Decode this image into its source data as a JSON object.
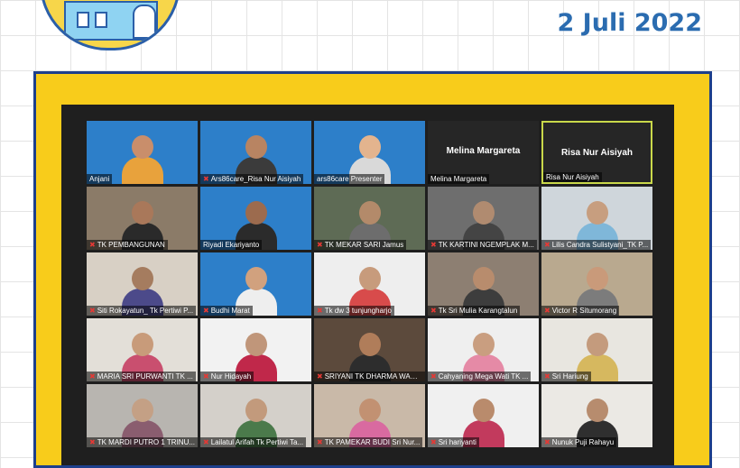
{
  "event": {
    "date": "2 Juli 2022"
  },
  "colors": {
    "frame": "#f8cc1b",
    "frame_border": "#1d3f8c",
    "date": "#2b6cb0",
    "mic_muted": "#e53935",
    "active_speaker": "#c9d84a"
  },
  "participants": [
    {
      "name": "Anjani",
      "muted": false,
      "style": "blue",
      "skin": "#c98e6b",
      "cloth": "#e8a23c"
    },
    {
      "name": "Ars86care_Risa Nur Aisiyah",
      "muted": true,
      "style": "blue",
      "skin": "#b88462",
      "cloth": "#3b3b3b"
    },
    {
      "name": "ars86care Presenter",
      "muted": false,
      "style": "blue",
      "skin": "#e3b48e",
      "cloth": "#d9d9d9"
    },
    {
      "name": "Melina Margareta",
      "muted": false,
      "style": "dark",
      "display": "Melina Margareta"
    },
    {
      "name": "Risa Nur Aisiyah",
      "muted": false,
      "style": "dark",
      "display": "Risa Nur Aisiyah",
      "active": true
    },
    {
      "name": "TK PEMBANGUNAN",
      "muted": true,
      "style": "photo",
      "bgc": "#8b7b68",
      "skin": "#a9785a",
      "cloth": "#2a2a2a"
    },
    {
      "name": "Riyadi Ekariyanto",
      "muted": false,
      "style": "blue",
      "skin": "#9c6b4e",
      "cloth": "#2b2b2b"
    },
    {
      "name": "TK MEKAR SARI Jamus",
      "muted": true,
      "style": "photo",
      "bgc": "#5e6b55",
      "skin": "#b38a6a",
      "cloth": "#6d6d6d"
    },
    {
      "name": "TK KARTINI NGEMPLAK M...",
      "muted": true,
      "style": "photo",
      "bgc": "#6e6e6e",
      "skin": "#b08b70",
      "cloth": "#444"
    },
    {
      "name": "Lilis Candra Sulistyani_TK P...",
      "muted": true,
      "style": "photo",
      "bgc": "#cfd6db",
      "skin": "#c79e7f",
      "cloth": "#7fb7d9"
    },
    {
      "name": "Siti Rokayatun_ Tk Pertiwi P...",
      "muted": true,
      "style": "photo",
      "bgc": "#d8d0c5",
      "skin": "#a57c5f",
      "cloth": "#4c4a8a"
    },
    {
      "name": "Budhi Marat",
      "muted": true,
      "style": "blue",
      "skin": "#d1a17e",
      "cloth": "#eeeeee"
    },
    {
      "name": "Tk dw 3 tunjungharjo",
      "muted": true,
      "style": "photo",
      "bgc": "#eeeeee",
      "skin": "#c79b7c",
      "cloth": "#d84b4b"
    },
    {
      "name": "Tk Sri Mulia Karangtalun",
      "muted": true,
      "style": "photo",
      "bgc": "#8d7f72",
      "skin": "#b88c6d",
      "cloth": "#3d3d3d"
    },
    {
      "name": "Victor R Situmorang",
      "muted": true,
      "style": "photo",
      "bgc": "#b9a98f",
      "skin": "#c99a7a",
      "cloth": "#7c7c7c"
    },
    {
      "name": "MARIA SRI PURWANTI TK ...",
      "muted": true,
      "style": "photo",
      "bgc": "#e3dfd8",
      "skin": "#c89b7a",
      "cloth": "#c94f6f"
    },
    {
      "name": "Nur Hidayah",
      "muted": true,
      "style": "photo",
      "bgc": "#f2f2f2",
      "skin": "#c0967a",
      "cloth": "#c0284a"
    },
    {
      "name": "SRIYANI TK DHARMA WANI...",
      "muted": true,
      "style": "photo",
      "bgc": "#5c4a3c",
      "skin": "#b07d5a",
      "cloth": "#2d2d2d"
    },
    {
      "name": "Cahyaning Mega Wati TK ...",
      "muted": true,
      "style": "photo",
      "bgc": "#efefef",
      "skin": "#c99e80",
      "cloth": "#e58aa6"
    },
    {
      "name": "Sri Hariung",
      "muted": true,
      "style": "photo",
      "bgc": "#e8e6e0",
      "skin": "#c49b7d",
      "cloth": "#d6b85f"
    },
    {
      "name": "TK MARDI PUTRO 1 TRINU...",
      "muted": true,
      "style": "photo",
      "bgc": "#b8b5b0",
      "skin": "#c4a085",
      "cloth": "#8a5d6f"
    },
    {
      "name": "Lailatul Arifah Tk Pertiwi Ta...",
      "muted": true,
      "style": "photo",
      "bgc": "#d4d0ca",
      "skin": "#c29a7c",
      "cloth": "#4b7a4b"
    },
    {
      "name": "TK PAMEKAR BUDI Sri Nur...",
      "muted": true,
      "style": "photo",
      "bgc": "#c9b9a8",
      "skin": "#c29172",
      "cloth": "#d96aa0"
    },
    {
      "name": "Sri hariyanti",
      "muted": true,
      "style": "photo",
      "bgc": "#f0f0f0",
      "skin": "#b98b6c",
      "cloth": "#c23a5d"
    },
    {
      "name": "Nunuk Puji Rahayu",
      "muted": true,
      "style": "photo",
      "bgc": "#ebe9e4",
      "skin": "#b78c6e",
      "cloth": "#2f2f2f"
    }
  ]
}
